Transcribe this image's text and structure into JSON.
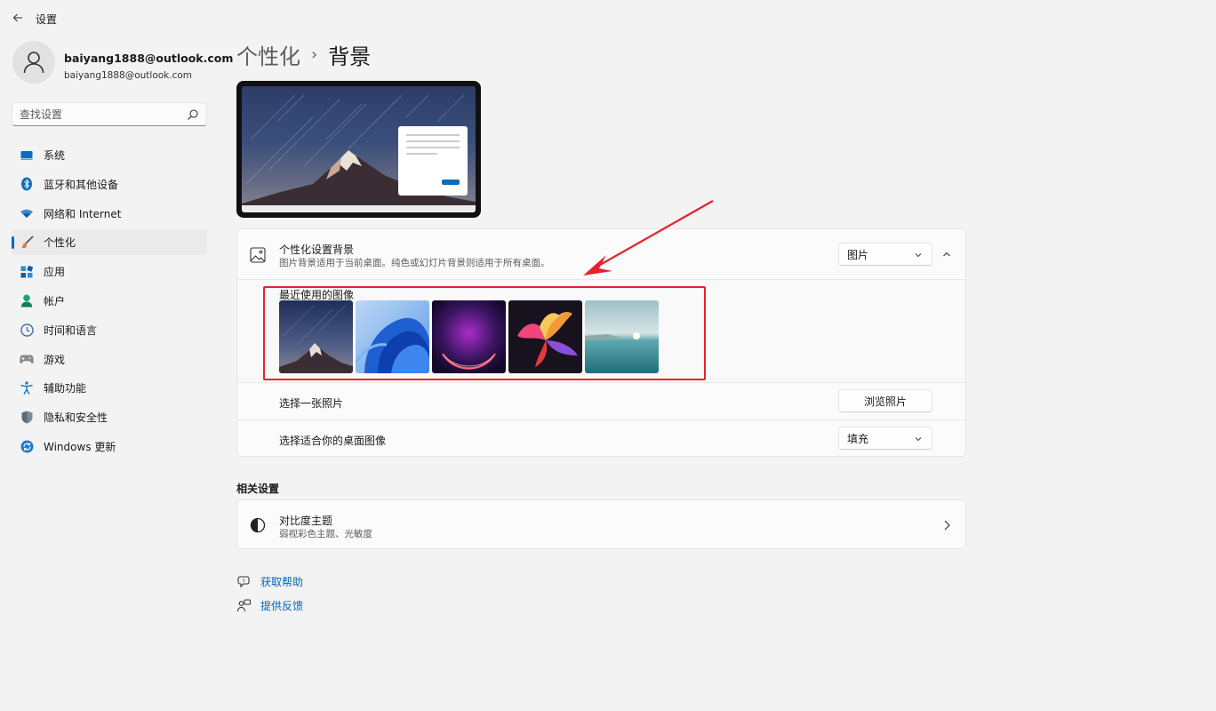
{
  "app": {
    "title": "设置"
  },
  "user": {
    "name": "baiyang1888@outlook.com",
    "email": "baiyang1888@outlook.com"
  },
  "search": {
    "placeholder": "查找设置"
  },
  "sidebar": {
    "items": [
      {
        "label": "系统",
        "icon": "system-icon"
      },
      {
        "label": "蓝牙和其他设备",
        "icon": "bluetooth-icon"
      },
      {
        "label": "网络和 Internet",
        "icon": "wifi-icon"
      },
      {
        "label": "个性化",
        "icon": "brush-icon",
        "active": true
      },
      {
        "label": "应用",
        "icon": "apps-icon"
      },
      {
        "label": "帐户",
        "icon": "account-icon"
      },
      {
        "label": "时间和语言",
        "icon": "clock-icon"
      },
      {
        "label": "游戏",
        "icon": "gamepad-icon"
      },
      {
        "label": "辅助功能",
        "icon": "accessibility-icon"
      },
      {
        "label": "隐私和安全性",
        "icon": "shield-icon"
      },
      {
        "label": "Windows 更新",
        "icon": "update-icon"
      }
    ]
  },
  "breadcrumb": {
    "parent": "个性化",
    "separator": "›",
    "current": "背景"
  },
  "background": {
    "title": "个性化设置背景",
    "subtitle": "图片背景适用于当前桌面。纯色或幻灯片背景则适用于所有桌面。",
    "type_value": "图片",
    "recent_label": "最近使用的图像",
    "recent_images": [
      "mountain-starry-night",
      "blue-bloom",
      "purple-glow",
      "colorful-flower",
      "seascape"
    ],
    "choose_photo_label": "选择一张照片",
    "browse_button": "浏览照片",
    "fit_label": "选择适合你的桌面图像",
    "fit_value": "填充"
  },
  "related": {
    "title": "相关设置",
    "contrast_title": "对比度主题",
    "contrast_subtitle": "弱视彩色主题、光敏度"
  },
  "links": {
    "help": "获取帮助",
    "feedback": "提供反馈"
  },
  "colors": {
    "accent": "#0067c0",
    "annotation": "#e3232c",
    "background": "#f3f3f3"
  }
}
